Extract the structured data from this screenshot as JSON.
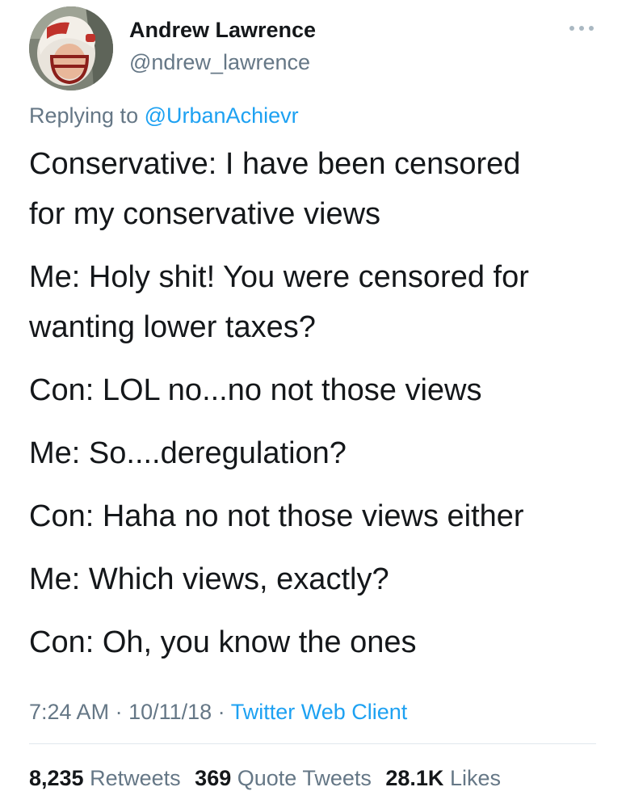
{
  "author": {
    "name": "Andrew Lawrence",
    "handle": "@ndrew_lawrence",
    "avatar_icon": "profile-photo-with-football-helmet"
  },
  "reply": {
    "prefix": "Replying to",
    "mention": "@UrbanAchievr"
  },
  "tweet": {
    "lines": [
      "Conservative: I have been censored",
      "for my conservative views",
      "Me: Holy shit! You were censored for",
      "wanting lower taxes?",
      "Con: LOL no...no not those views",
      "Me: So....deregulation?",
      "Con: Haha no not those views either",
      "Me: Which views, exactly?",
      "Con: Oh, you know the ones"
    ]
  },
  "meta": {
    "time": "7:24 AM",
    "sep1": " · ",
    "date": "10/11/18",
    "sep2": " · ",
    "client": "Twitter Web Client"
  },
  "stats": {
    "retweets_count": "8,235",
    "retweets_label": "Retweets",
    "quotes_count": "369",
    "quotes_label": "Quote Tweets",
    "likes_count": "28.1K",
    "likes_label": "Likes"
  },
  "colors": {
    "text": "#14171a",
    "secondary": "#657786",
    "link": "#1da1f2",
    "divider": "#e1e8ed"
  }
}
